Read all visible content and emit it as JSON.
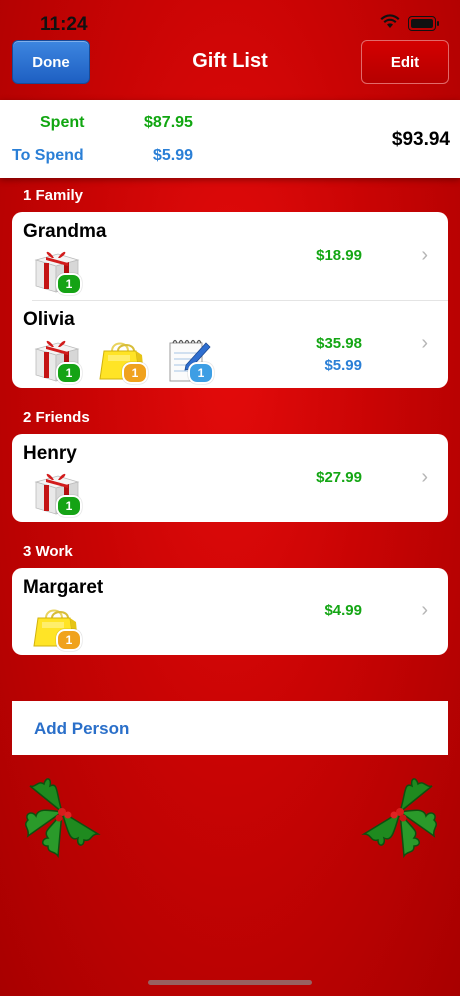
{
  "status": {
    "time": "11:24"
  },
  "nav": {
    "done_label": "Done",
    "title": "Gift List",
    "edit_label": "Edit"
  },
  "summary": {
    "spent_label": "Spent",
    "spent_value": "$87.95",
    "to_spend_label": "To Spend",
    "to_spend_value": "$5.99",
    "total": "$93.94"
  },
  "sections": [
    {
      "header": "1 Family",
      "people": [
        {
          "name": "Grandma",
          "spent": "$18.99",
          "icons": [
            {
              "icon": "gift-box-icon",
              "count": "1"
            }
          ]
        },
        {
          "name": "Olivia",
          "spent": "$35.98",
          "to_spend": "$5.99",
          "icons": [
            {
              "icon": "gift-box-icon",
              "count": "1"
            },
            {
              "icon": "shopping-bag-icon",
              "count": "1"
            },
            {
              "icon": "notepad-icon",
              "count": "1"
            }
          ]
        }
      ]
    },
    {
      "header": "2 Friends",
      "people": [
        {
          "name": "Henry",
          "spent": "$27.99",
          "icons": [
            {
              "icon": "gift-box-icon",
              "count": "1"
            }
          ]
        }
      ]
    },
    {
      "header": "3 Work",
      "people": [
        {
          "name": "Margaret",
          "spent": "$4.99",
          "icons": [
            {
              "icon": "shopping-bag-icon",
              "count": "1"
            }
          ]
        }
      ]
    }
  ],
  "add_person": "Add Person",
  "colors": {
    "background": "#c90404",
    "spent_green": "#14a614",
    "to_spend_blue": "#2a7fd6",
    "done_blue": "#1e5fc2"
  }
}
